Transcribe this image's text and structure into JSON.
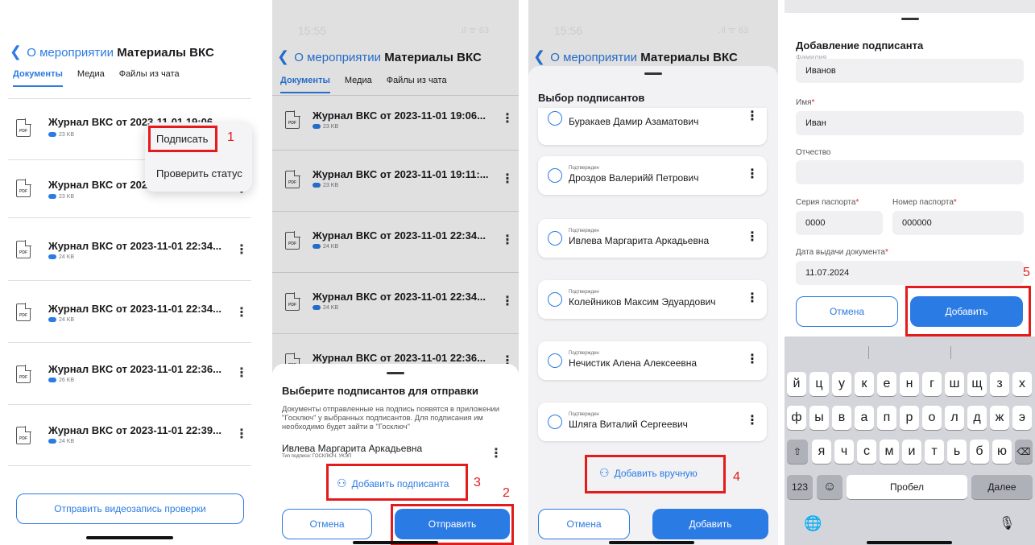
{
  "nav": {
    "back_link": "О мероприятии",
    "title": "Материалы ВКС"
  },
  "tabs": [
    "Документы",
    "Медиа",
    "Файлы из чата"
  ],
  "panel1": {
    "files": [
      {
        "name": "Журнал ВКС от 2023-11-01 19:06",
        "size": "23 KB"
      },
      {
        "name": "Журнал ВКС от 2023",
        "size": "23 KB"
      },
      {
        "name": "Журнал ВКС от 2023-11-01 22:34...",
        "size": "24 KB"
      },
      {
        "name": "Журнал ВКС от 2023-11-01 22:34...",
        "size": "24 KB"
      },
      {
        "name": "Журнал ВКС от 2023-11-01 22:36...",
        "size": "26 KB"
      },
      {
        "name": "Журнал ВКС от 2023-11-01 22:39...",
        "size": "24 KB"
      }
    ],
    "menu": {
      "sign": "Подписать",
      "check": "Проверить статус"
    },
    "send_video_button": "Отправить видеозапись проверки",
    "marker1": "1"
  },
  "panel2": {
    "status_time": "15:55",
    "status_icons": ".ıl ᯤ 63",
    "files": [
      {
        "name": "Журнал ВКС от 2023-11-01 19:06...",
        "size": "23 KB"
      },
      {
        "name": "Журнал ВКС от 2023-11-01 19:11:...",
        "size": "23 KB"
      },
      {
        "name": "Журнал ВКС от 2023-11-01 22:34...",
        "size": "24 KB"
      },
      {
        "name": "Журнал ВКС от 2023-11-01 22:34...",
        "size": "24 KB"
      },
      {
        "name": "Журнал ВКС от 2023-11-01 22:36...",
        "size": ""
      }
    ],
    "sheet_title": "Выберите подписантов для отправки",
    "sheet_desc": "Документы отправленные на подпись появятся в приложении \"Госключ\" у выбранных подписантов. Для подписания им необходимо будет зайти в \"Госключ\"",
    "signer_name": "Ивлева Маргарита Аркадьевна",
    "signer_type": "Тип подписи: ГОСКЛЮЧ. УКЭП",
    "add_signer": "Добавить подписанта",
    "cancel": "Отмена",
    "send": "Отправить",
    "marker2": "2",
    "marker3": "3"
  },
  "panel3": {
    "status_time": "15:56",
    "status_icons": ".ıl ᯤ 63",
    "sheet_title": "Выбор подписантов",
    "partial_name": "Буракаев Дамир Азаматович",
    "signers": [
      {
        "status": "Подтвержден",
        "name": "Дроздов Валерийй Петрович"
      },
      {
        "status": "Подтвержден",
        "name": "Ивлева Маргарита Аркадьевна"
      },
      {
        "status": "Подтвержден",
        "name": "Колейников Максим Эдуардович"
      },
      {
        "status": "Подтвержден",
        "name": "Нечистик Алена Алексеевна"
      },
      {
        "status": "Подтвержден",
        "name": "Шляга Виталий Сергеевич"
      }
    ],
    "add_manual": "Добавить вручную",
    "cancel": "Отмена",
    "add": "Добавить",
    "marker4": "4"
  },
  "panel4": {
    "title": "Добавление подписанта",
    "cut_label": "Фамилия",
    "surname_value": "Иванов",
    "name_label": "Имя",
    "name_value": "Иван",
    "patronymic_label": "Отчество",
    "patronymic_value": "",
    "series_label": "Серия паспорта",
    "series_value": "0000",
    "number_label": "Номер паспорта",
    "number_value": "000000",
    "date_label": "Дата выдачи документа",
    "date_value": "11.07.2024",
    "required_mark": "*",
    "cancel": "Отмена",
    "add": "Добавить",
    "marker5": "5",
    "keyboard": {
      "row1": [
        "й",
        "ц",
        "у",
        "к",
        "е",
        "н",
        "г",
        "ш",
        "щ",
        "з",
        "х"
      ],
      "row2": [
        "ф",
        "ы",
        "в",
        "а",
        "п",
        "р",
        "о",
        "л",
        "д",
        "ж",
        "э"
      ],
      "row3": [
        "я",
        "ч",
        "с",
        "м",
        "и",
        "т",
        "ь",
        "б",
        "ю"
      ],
      "shift": "⇧",
      "backspace": "⌫",
      "num": "123",
      "emoji": "☺",
      "space": "Пробел",
      "next": "Далее",
      "globe": "🌐",
      "mic": "🎙"
    }
  }
}
